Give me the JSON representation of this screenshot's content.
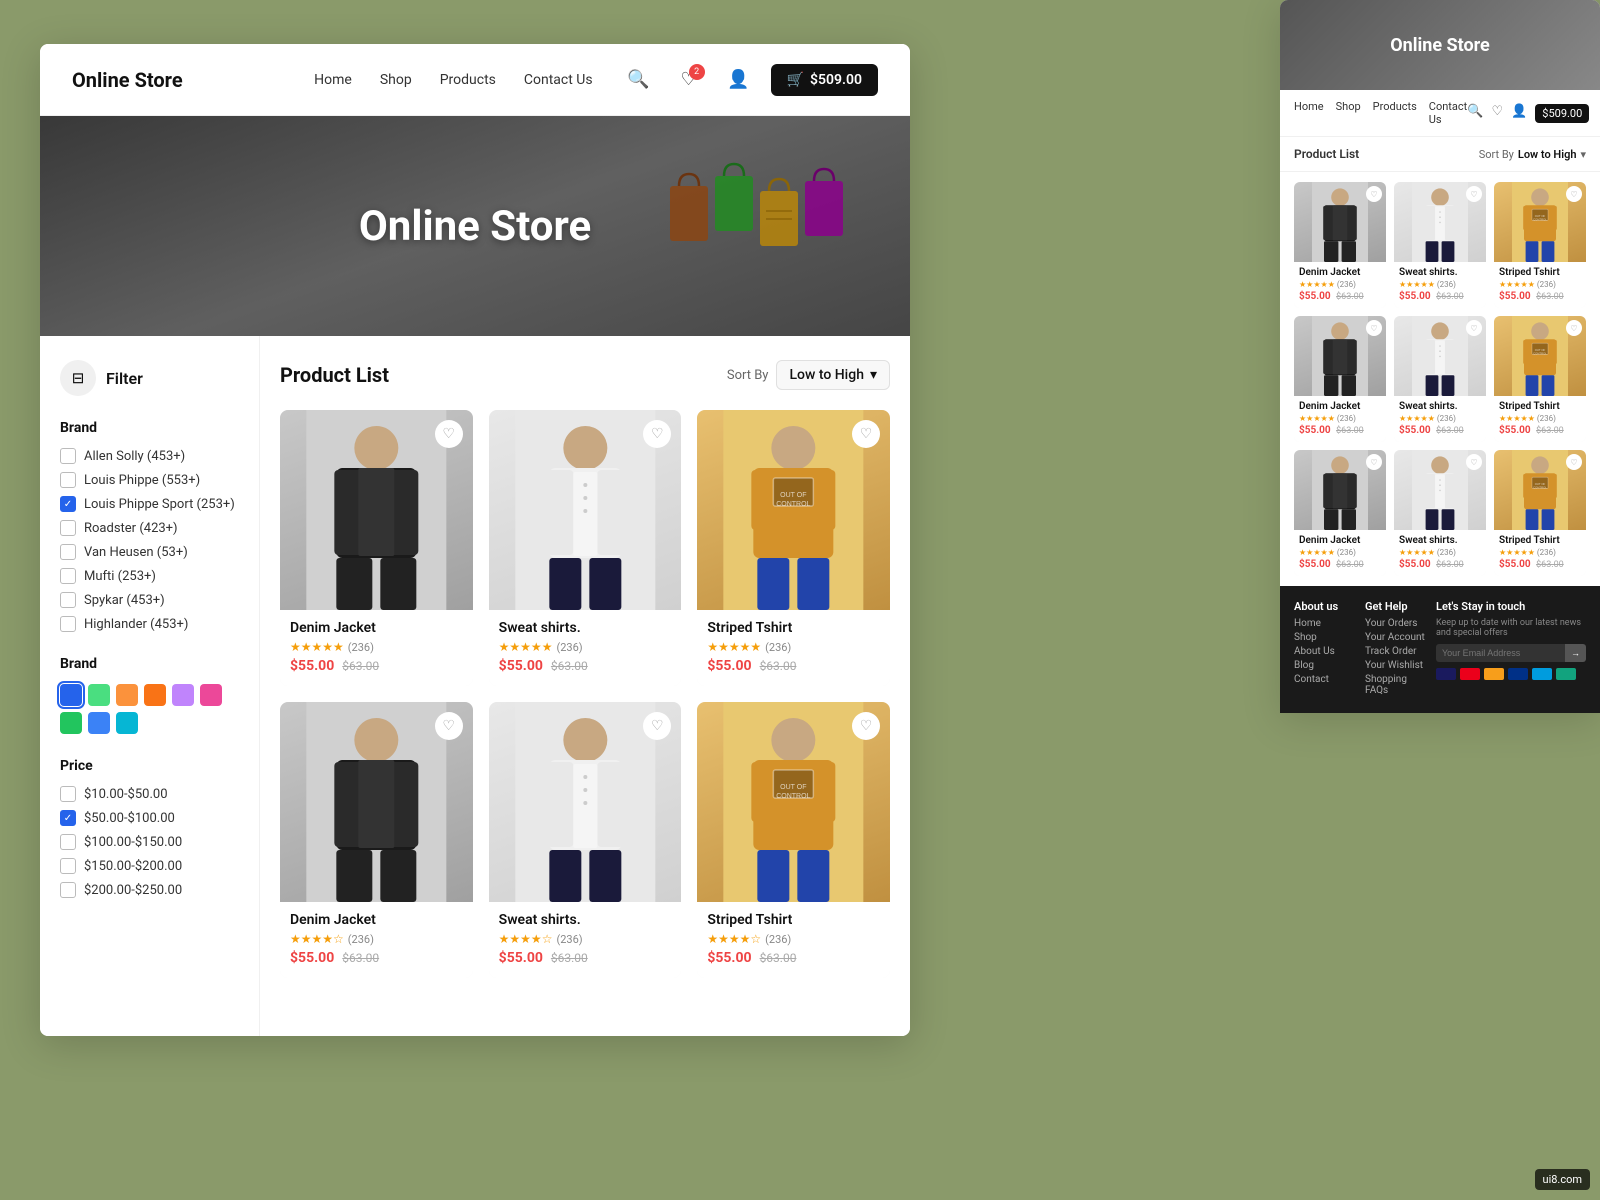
{
  "brand": {
    "name": "Online Store"
  },
  "header": {
    "nav": [
      "Home",
      "Shop",
      "Products",
      "Contact Us"
    ],
    "cart_amount": "$509.00",
    "heart_count": "2"
  },
  "hero": {
    "title": "Online Store"
  },
  "filter": {
    "label": "Filter",
    "brand_section": "Brand",
    "color_section": "Brand",
    "price_section": "Price",
    "brands": [
      {
        "name": "Allen Solly (453+)",
        "checked": false
      },
      {
        "name": "Louis Phippe (553+)",
        "checked": false
      },
      {
        "name": "Louis Phippe Sport (253+)",
        "checked": true
      },
      {
        "name": "Roadster (423+)",
        "checked": false
      },
      {
        "name": "Van Heusen (53+)",
        "checked": false
      },
      {
        "name": "Mufti (253+)",
        "checked": false
      },
      {
        "name": "Spykar (453+)",
        "checked": false
      },
      {
        "name": "Highlander (453+)",
        "checked": false
      }
    ],
    "colors": [
      "#2563eb",
      "#4ade80",
      "#fb923c",
      "#f97316",
      "#c084fc",
      "#ec4899",
      "#22c55e",
      "#3b82f6",
      "#06b6d4"
    ],
    "prices": [
      {
        "range": "$10.00-$50.00",
        "checked": false
      },
      {
        "range": "$50.00-$100.00",
        "checked": true
      },
      {
        "range": "$100.00-$150.00",
        "checked": false
      },
      {
        "range": "$150.00-$200.00",
        "checked": false
      },
      {
        "range": "$200.00-$250.00",
        "checked": false
      }
    ]
  },
  "product_list": {
    "title": "Product List",
    "sort_label": "Sort By",
    "sort_value": "Low to High"
  },
  "products": [
    {
      "name": "Denim Jacket",
      "rating": 5,
      "reviews": 236,
      "price": "$55.00",
      "original_price": "$63.00",
      "type": "jacket"
    },
    {
      "name": "Sweat shirts.",
      "rating": 5,
      "reviews": 236,
      "price": "$55.00",
      "original_price": "$63.00",
      "type": "shirt"
    },
    {
      "name": "Striped Tshirt",
      "rating": 5,
      "reviews": 236,
      "price": "$55.00",
      "original_price": "$63.00",
      "type": "tshirt"
    },
    {
      "name": "Denim Jacket",
      "rating": 4,
      "reviews": 236,
      "price": "$55.00",
      "original_price": "$63.00",
      "type": "jacket"
    },
    {
      "name": "Sweat shirts.",
      "rating": 4,
      "reviews": 236,
      "price": "$55.00",
      "original_price": "$63.00",
      "type": "shirt"
    },
    {
      "name": "Striped Tshirt",
      "rating": 4,
      "reviews": 236,
      "price": "$55.00",
      "original_price": "$63.00",
      "type": "tshirt"
    }
  ],
  "back_window": {
    "brand": "Online Store",
    "nav_links": [
      "Home",
      "Shop",
      "Products",
      "Contact Us"
    ],
    "product_list_label": "Product List",
    "sort_label": "Sort By",
    "sort_value": "Low to High",
    "products": [
      {
        "name": "Denim Jacket",
        "price": "$55.00",
        "original": "$63.00",
        "type": "jacket"
      },
      {
        "name": "Sweat shirts.",
        "price": "$55.00",
        "original": "$63.00",
        "type": "shirt"
      },
      {
        "name": "Striped Tshirt",
        "price": "$55.00",
        "original": "$63.00",
        "type": "tshirt"
      },
      {
        "name": "Denim Jacket",
        "price": "$55.00",
        "original": "$63.00",
        "type": "jacket"
      },
      {
        "name": "Sweat shirts.",
        "price": "$55.00",
        "original": "$63.00",
        "type": "shirt"
      },
      {
        "name": "Striped Tshirt",
        "price": "$55.00",
        "original": "$63.00",
        "type": "tshirt"
      },
      {
        "name": "Denim Jacket",
        "price": "$55.00",
        "original": "$63.00",
        "type": "jacket"
      },
      {
        "name": "Sweat shirts.",
        "price": "$55.00",
        "original": "$63.00",
        "type": "shirt"
      },
      {
        "name": "Striped Tshirt",
        "price": "$55.00",
        "original": "$63.00",
        "type": "tshirt"
      }
    ],
    "footer": {
      "col1_title": "About us",
      "col1_links": [
        "Home",
        "Shop",
        "About Us",
        "Blog",
        "Contact"
      ],
      "col2_title": "Get Help",
      "col2_links": [
        "Your Orders",
        "Your Account",
        "Track Order",
        "Your Wishlist",
        "Shopping FAQs"
      ],
      "col3_title": "Let's Stay in touch",
      "col3_email_placeholder": "Your Email Address"
    }
  },
  "watermark": "ui8.com"
}
